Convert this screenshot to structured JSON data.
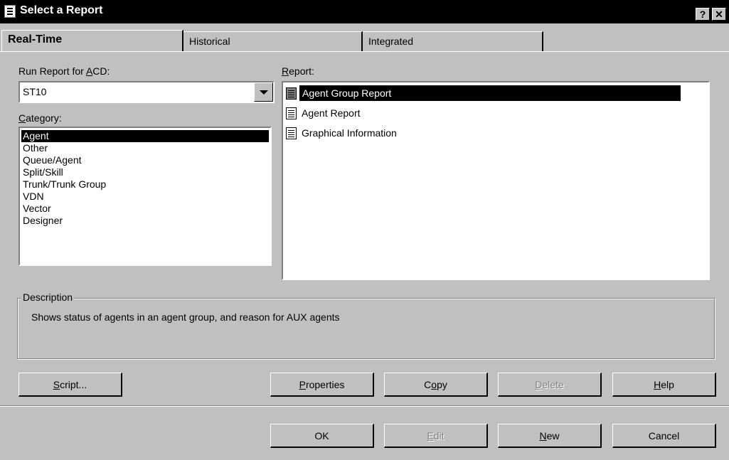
{
  "window": {
    "title": "Select a Report",
    "help_glyph": "?",
    "close_glyph": "✕"
  },
  "tabs": [
    {
      "label": "Real-Time"
    },
    {
      "label": "Historical"
    },
    {
      "label": "Integrated"
    }
  ],
  "acd": {
    "label_pre": "Run Report for ",
    "label_key": "A",
    "label_post": "CD:",
    "value": "ST10"
  },
  "category": {
    "label_key": "C",
    "label_post": "ategory:",
    "items": [
      "Agent",
      "Other",
      "Queue/Agent",
      "Split/Skill",
      "Trunk/Trunk Group",
      "VDN",
      "Vector",
      "Designer"
    ],
    "selected": "Agent"
  },
  "report": {
    "label_key": "R",
    "label_post": "eport:",
    "items": [
      "Agent Group Report",
      "Agent Report",
      "Graphical Information"
    ],
    "selected": "Agent Group Report"
  },
  "description": {
    "title": "Description",
    "text": "Shows status of agents in an agent group, and reason for AUX agents"
  },
  "buttons_row1": {
    "script": {
      "key": "S",
      "rest": "cript..."
    },
    "properties": {
      "key": "P",
      "rest": "roperties"
    },
    "copy": {
      "pre": "C",
      "key": "o",
      "rest": "py"
    },
    "delete": {
      "key": "D",
      "rest": "elete"
    },
    "help": {
      "key": "H",
      "rest": "elp"
    }
  },
  "buttons_row2": {
    "ok": "OK",
    "edit": {
      "key": "E",
      "rest": "dit"
    },
    "new": {
      "key": "N",
      "rest": "ew"
    },
    "cancel": "Cancel"
  }
}
